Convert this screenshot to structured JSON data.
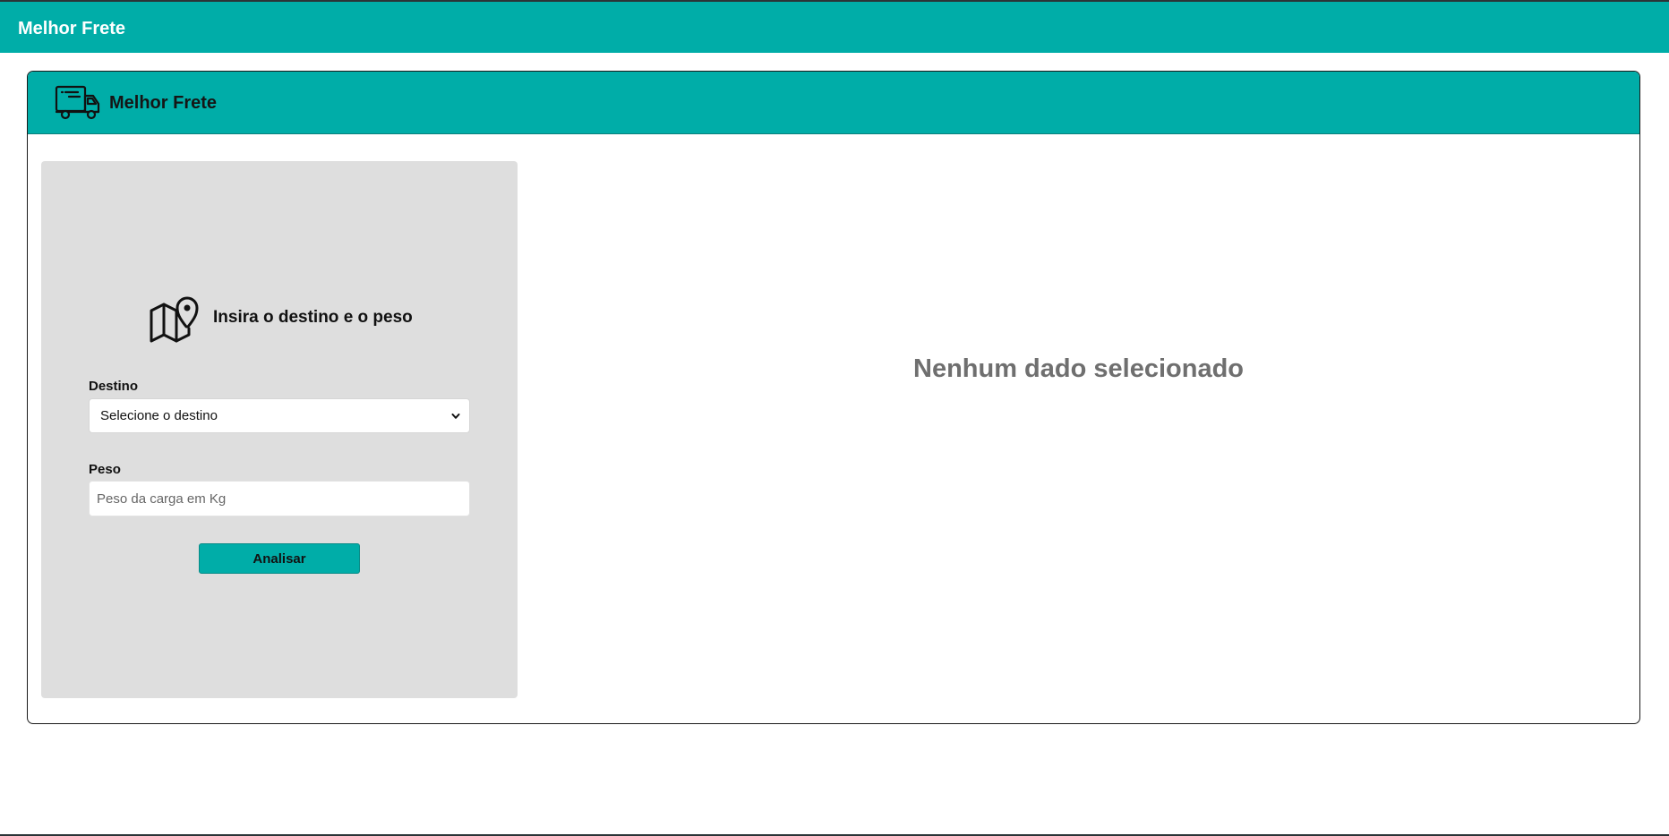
{
  "navbar": {
    "brand": "Melhor Frete"
  },
  "card": {
    "title": "Melhor Frete",
    "icon": "truck-icon"
  },
  "form": {
    "heading": "Insira o destino e o peso",
    "heading_icon": "map-pin-icon",
    "destino": {
      "label": "Destino",
      "selected": "Selecione o destino"
    },
    "peso": {
      "label": "Peso",
      "placeholder": "Peso da carga em Kg",
      "value": ""
    },
    "submit_label": "Analisar"
  },
  "result": {
    "empty_message": "Nenhum dado selecionado"
  },
  "colors": {
    "accent": "#00ada8",
    "panel": "#dedede",
    "muted_text": "#6f6f6f"
  }
}
